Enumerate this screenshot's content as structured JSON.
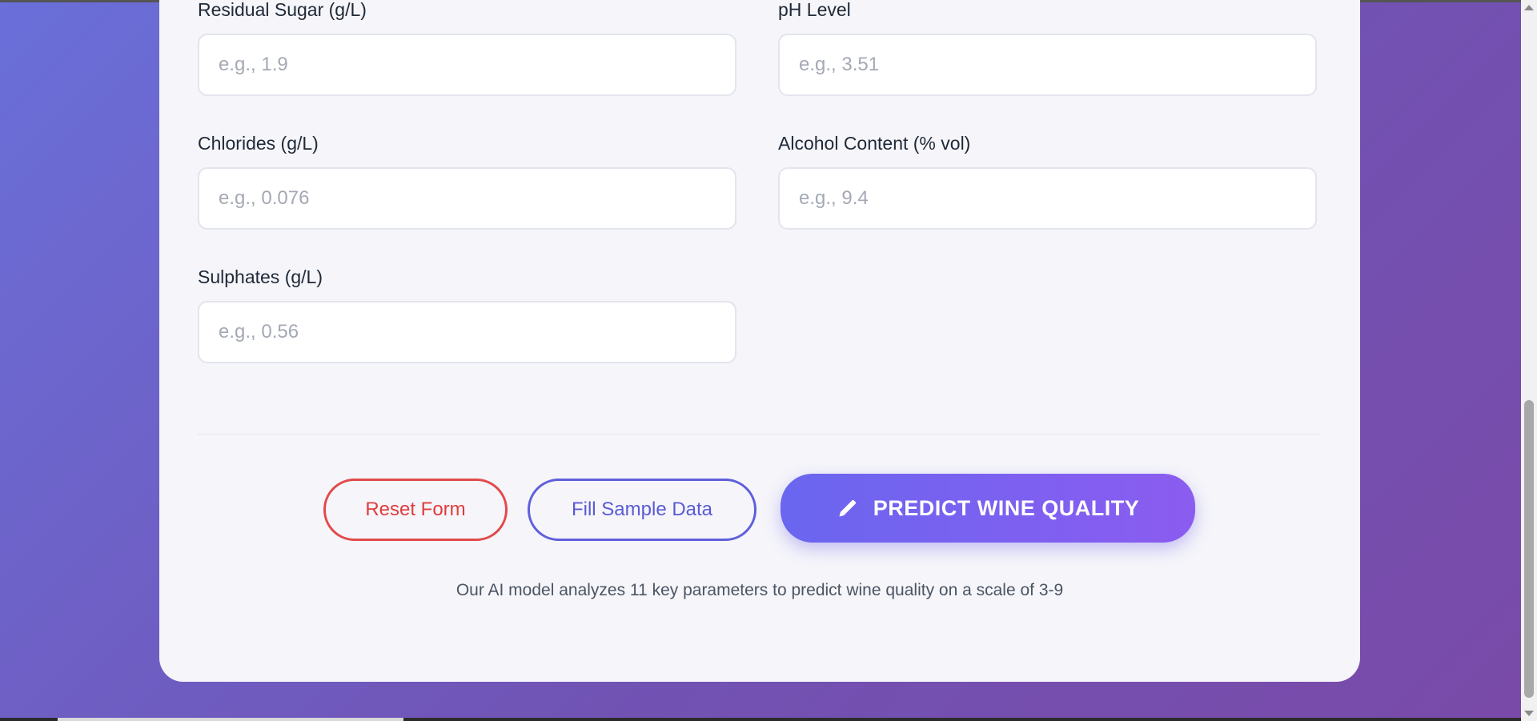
{
  "form": {
    "fields": [
      {
        "label": "Residual Sugar (g/L)",
        "placeholder": "e.g., 1.9"
      },
      {
        "label": "pH Level",
        "placeholder": "e.g., 3.51"
      },
      {
        "label": "Chlorides (g/L)",
        "placeholder": "e.g., 0.076"
      },
      {
        "label": "Alcohol Content (% vol)",
        "placeholder": "e.g., 9.4"
      },
      {
        "label": "Sulphates (g/L)",
        "placeholder": "e.g., 0.56"
      }
    ]
  },
  "actions": {
    "reset_label": "Reset Form",
    "sample_label": "Fill Sample Data",
    "predict_label": "PREDICT WINE QUALITY",
    "predict_icon": "pencil-icon"
  },
  "note": "Our AI model analyzes 11 key parameters to predict wine quality on a scale of 3-9",
  "colors": {
    "accent": "#6a66ef",
    "reset": "#e03c3c",
    "sample": "#5a5ad6"
  }
}
